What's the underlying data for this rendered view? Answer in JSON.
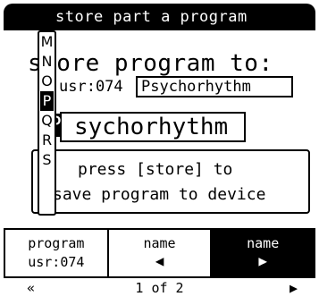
{
  "title_bar": {
    "text": "store part a program"
  },
  "heading": "store program to:",
  "source": {
    "label": "usr:074",
    "name": "Psychorhythm"
  },
  "name_field": {
    "cursor_char": "P",
    "rest": "sychorhythm"
  },
  "message": {
    "line1": "press [store] to",
    "line2": "save program to device"
  },
  "letter_picker": {
    "items": [
      "M",
      "N",
      "O",
      "P",
      "Q",
      "R",
      "S"
    ],
    "selected": "P"
  },
  "softkeys": [
    {
      "line1": "program",
      "line2": "usr:074"
    },
    {
      "line1": "name",
      "arrow": "◀"
    },
    {
      "line1": "name",
      "arrow": "▶"
    }
  ],
  "footer": {
    "prev": "«",
    "page": "1 of 2",
    "next": "▶"
  }
}
